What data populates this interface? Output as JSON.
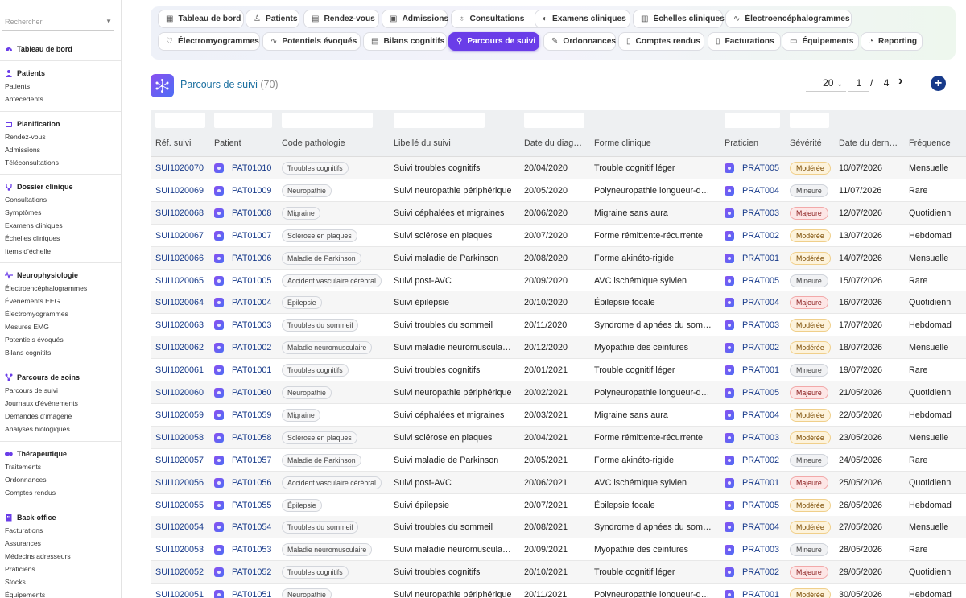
{
  "sidebar": {
    "search_placeholder": "Rechercher",
    "sections": [
      {
        "title": "Tableau de bord",
        "icon": "dashboard-icon",
        "color": "#6a3de8",
        "items": []
      },
      {
        "title": "Patients",
        "icon": "user-icon",
        "color": "#6a3de8",
        "items": [
          "Patients",
          "Antécédents"
        ]
      },
      {
        "title": "Planification",
        "icon": "calendar-icon",
        "color": "#6a3de8",
        "items": [
          "Rendez-vous",
          "Admissions",
          "Téléconsultations"
        ]
      },
      {
        "title": "Dossier clinique",
        "icon": "stethoscope-icon",
        "color": "#6a3de8",
        "items": [
          "Consultations",
          "Symptômes",
          "Examens cliniques",
          "Échelles cliniques",
          "Items d'échelle"
        ]
      },
      {
        "title": "Neurophysiologie",
        "icon": "waveform-icon",
        "color": "#6a3de8",
        "items": [
          "Électroencéphalogrammes",
          "Événements EEG",
          "Électromyogrammes",
          "Mesures EMG",
          "Potentiels évoqués",
          "Bilans cognitifs"
        ]
      },
      {
        "title": "Parcours de soins",
        "icon": "pathway-icon",
        "color": "#6a3de8",
        "items": [
          "Parcours de suivi",
          "Journaux d'événements",
          "Demandes d'imagerie",
          "Analyses biologiques"
        ]
      },
      {
        "title": "Thérapeutique",
        "icon": "pills-icon",
        "color": "#6a3de8",
        "items": [
          "Traitements",
          "Ordonnances",
          "Comptes rendus"
        ]
      },
      {
        "title": "Back-office",
        "icon": "building-icon",
        "color": "#6a3de8",
        "items": [
          "Facturations",
          "Assurances",
          "Médecins adresseurs",
          "Praticiens",
          "Stocks",
          "Équipements"
        ]
      }
    ]
  },
  "tabs": [
    {
      "label": "Tableau de bord",
      "icon": "▦"
    },
    {
      "label": "Patients",
      "icon": "♙"
    },
    {
      "label": "Rendez-vous",
      "icon": "▤"
    },
    {
      "label": "Admissions",
      "icon": "▣"
    },
    {
      "label": "Consultations",
      "icon": "♁"
    },
    {
      "label": "Examens cliniques",
      "icon": "◐"
    },
    {
      "label": "Échelles cliniques",
      "icon": "▥"
    },
    {
      "label": "Électroencéphalogrammes",
      "icon": "∿"
    },
    {
      "label": "Électromyogrammes",
      "icon": "♡"
    },
    {
      "label": "Potentiels évoqués",
      "icon": "∿"
    },
    {
      "label": "Bilans cognitifs",
      "icon": "▤"
    },
    {
      "label": "Parcours de suivi",
      "icon": "⚲",
      "active": true
    },
    {
      "label": "Ordonnances",
      "icon": "✎"
    },
    {
      "label": "Comptes rendus",
      "icon": "▯"
    },
    {
      "label": "Facturations",
      "icon": "▯"
    },
    {
      "label": "Équipements",
      "icon": "▭"
    },
    {
      "label": "Reporting",
      "icon": "◔"
    }
  ],
  "header": {
    "title": "Parcours de suivi",
    "count": "(70)",
    "page_size": "20",
    "page": "1",
    "page_sep": "/",
    "total_pages": "4"
  },
  "columns": [
    "Réf. suivi",
    "Patient",
    "Code pathologie",
    "Libellé du suivi",
    "Date du diag…",
    "Forme clinique",
    "Praticien",
    "Sévérité",
    "Date du dern…",
    "Fréquence"
  ],
  "severity_colors": {
    "Modérée": {
      "bg": "#fdf3dc",
      "border": "#f0cf8a",
      "text": "#7a4a00"
    },
    "Mineure": {
      "bg": "#f1f2f4",
      "border": "#cfd3da",
      "text": "#444"
    },
    "Majeure": {
      "bg": "#fde6e6",
      "border": "#f2a9a9",
      "text": "#8a1c1c"
    }
  },
  "rows": [
    {
      "ref": "SUI1020070",
      "patient": "PAT01010",
      "code": "Troubles cognitifs",
      "label": "Suivi troubles cognitifs",
      "date": "20/04/2020",
      "forme": "Trouble cognitif léger",
      "praticien": "PRAT005",
      "sev": "Modérée",
      "last": "10/07/2026",
      "freq": "Mensuelle"
    },
    {
      "ref": "SUI1020069",
      "patient": "PAT01009",
      "code": "Neuropathie",
      "label": "Suivi neuropathie périphérique",
      "date": "20/05/2020",
      "forme": "Polyneuropathie longueur-d…",
      "praticien": "PRAT004",
      "sev": "Mineure",
      "last": "11/07/2026",
      "freq": "Rare"
    },
    {
      "ref": "SUI1020068",
      "patient": "PAT01008",
      "code": "Migraine",
      "label": "Suivi céphalées et migraines",
      "date": "20/06/2020",
      "forme": "Migraine sans aura",
      "praticien": "PRAT003",
      "sev": "Majeure",
      "last": "12/07/2026",
      "freq": "Quotidienn"
    },
    {
      "ref": "SUI1020067",
      "patient": "PAT01007",
      "code": "Sclérose en plaques",
      "label": "Suivi sclérose en plaques",
      "date": "20/07/2020",
      "forme": "Forme rémittente-récurrente",
      "praticien": "PRAT002",
      "sev": "Modérée",
      "last": "13/07/2026",
      "freq": "Hebdomad"
    },
    {
      "ref": "SUI1020066",
      "patient": "PAT01006",
      "code": "Maladie de Parkinson",
      "label": "Suivi maladie de Parkinson",
      "date": "20/08/2020",
      "forme": "Forme akinéto-rigide",
      "praticien": "PRAT001",
      "sev": "Modérée",
      "last": "14/07/2026",
      "freq": "Mensuelle"
    },
    {
      "ref": "SUI1020065",
      "patient": "PAT01005",
      "code": "Accident vasculaire cérébral",
      "label": "Suivi post-AVC",
      "date": "20/09/2020",
      "forme": "AVC ischémique sylvien",
      "praticien": "PRAT005",
      "sev": "Mineure",
      "last": "15/07/2026",
      "freq": "Rare"
    },
    {
      "ref": "SUI1020064",
      "patient": "PAT01004",
      "code": "Épilepsie",
      "label": "Suivi épilepsie",
      "date": "20/10/2020",
      "forme": "Épilepsie focale",
      "praticien": "PRAT004",
      "sev": "Majeure",
      "last": "16/07/2026",
      "freq": "Quotidienn"
    },
    {
      "ref": "SUI1020063",
      "patient": "PAT01003",
      "code": "Troubles du sommeil",
      "label": "Suivi troubles du sommeil",
      "date": "20/11/2020",
      "forme": "Syndrome d apnées du som…",
      "praticien": "PRAT003",
      "sev": "Modérée",
      "last": "17/07/2026",
      "freq": "Hebdomad"
    },
    {
      "ref": "SUI1020062",
      "patient": "PAT01002",
      "code": "Maladie neuromusculaire",
      "label": "Suivi maladie neuromuscula…",
      "date": "20/12/2020",
      "forme": "Myopathie des ceintures",
      "praticien": "PRAT002",
      "sev": "Modérée",
      "last": "18/07/2026",
      "freq": "Mensuelle"
    },
    {
      "ref": "SUI1020061",
      "patient": "PAT01001",
      "code": "Troubles cognitifs",
      "label": "Suivi troubles cognitifs",
      "date": "20/01/2021",
      "forme": "Trouble cognitif léger",
      "praticien": "PRAT001",
      "sev": "Mineure",
      "last": "19/07/2026",
      "freq": "Rare"
    },
    {
      "ref": "SUI1020060",
      "patient": "PAT01060",
      "code": "Neuropathie",
      "label": "Suivi neuropathie périphérique",
      "date": "20/02/2021",
      "forme": "Polyneuropathie longueur-d…",
      "praticien": "PRAT005",
      "sev": "Majeure",
      "last": "21/05/2026",
      "freq": "Quotidienn"
    },
    {
      "ref": "SUI1020059",
      "patient": "PAT01059",
      "code": "Migraine",
      "label": "Suivi céphalées et migraines",
      "date": "20/03/2021",
      "forme": "Migraine sans aura",
      "praticien": "PRAT004",
      "sev": "Modérée",
      "last": "22/05/2026",
      "freq": "Hebdomad"
    },
    {
      "ref": "SUI1020058",
      "patient": "PAT01058",
      "code": "Sclérose en plaques",
      "label": "Suivi sclérose en plaques",
      "date": "20/04/2021",
      "forme": "Forme rémittente-récurrente",
      "praticien": "PRAT003",
      "sev": "Modérée",
      "last": "23/05/2026",
      "freq": "Mensuelle"
    },
    {
      "ref": "SUI1020057",
      "patient": "PAT01057",
      "code": "Maladie de Parkinson",
      "label": "Suivi maladie de Parkinson",
      "date": "20/05/2021",
      "forme": "Forme akinéto-rigide",
      "praticien": "PRAT002",
      "sev": "Mineure",
      "last": "24/05/2026",
      "freq": "Rare"
    },
    {
      "ref": "SUI1020056",
      "patient": "PAT01056",
      "code": "Accident vasculaire cérébral",
      "label": "Suivi post-AVC",
      "date": "20/06/2021",
      "forme": "AVC ischémique sylvien",
      "praticien": "PRAT001",
      "sev": "Majeure",
      "last": "25/05/2026",
      "freq": "Quotidienn"
    },
    {
      "ref": "SUI1020055",
      "patient": "PAT01055",
      "code": "Épilepsie",
      "label": "Suivi épilepsie",
      "date": "20/07/2021",
      "forme": "Épilepsie focale",
      "praticien": "PRAT005",
      "sev": "Modérée",
      "last": "26/05/2026",
      "freq": "Hebdomad"
    },
    {
      "ref": "SUI1020054",
      "patient": "PAT01054",
      "code": "Troubles du sommeil",
      "label": "Suivi troubles du sommeil",
      "date": "20/08/2021",
      "forme": "Syndrome d apnées du som…",
      "praticien": "PRAT004",
      "sev": "Modérée",
      "last": "27/05/2026",
      "freq": "Mensuelle"
    },
    {
      "ref": "SUI1020053",
      "patient": "PAT01053",
      "code": "Maladie neuromusculaire",
      "label": "Suivi maladie neuromuscula…",
      "date": "20/09/2021",
      "forme": "Myopathie des ceintures",
      "praticien": "PRAT003",
      "sev": "Mineure",
      "last": "28/05/2026",
      "freq": "Rare"
    },
    {
      "ref": "SUI1020052",
      "patient": "PAT01052",
      "code": "Troubles cognitifs",
      "label": "Suivi troubles cognitifs",
      "date": "20/10/2021",
      "forme": "Trouble cognitif léger",
      "praticien": "PRAT002",
      "sev": "Majeure",
      "last": "29/05/2026",
      "freq": "Quotidienn"
    },
    {
      "ref": "SUI1020051",
      "patient": "PAT01051",
      "code": "Neuropathie",
      "label": "Suivi neuropathie périphérique",
      "date": "20/11/2021",
      "forme": "Polyneuropathie longueur-d…",
      "praticien": "PRAT001",
      "sev": "Modérée",
      "last": "30/05/2026",
      "freq": "Hebdomad"
    }
  ]
}
